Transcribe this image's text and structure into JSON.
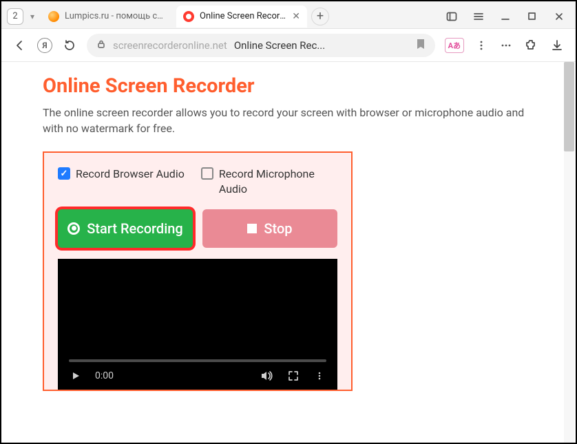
{
  "window": {
    "tab_count": "2"
  },
  "tabs": [
    {
      "label": "Lumpics.ru - помощь с кон",
      "active": false
    },
    {
      "label": "Online Screen Recorder",
      "active": true
    }
  ],
  "addressbar": {
    "domain": "screenrecorderonline.net",
    "page_title_short": "Online Screen Rec...",
    "translate_badge": "Aあ"
  },
  "page": {
    "heading": "Online Screen Recorder",
    "lead": "The online screen recorder allows you to record your screen with browser or microphone audio and with no watermark for free."
  },
  "recorder": {
    "checkbox_browser_audio": "Record Browser Audio",
    "checkbox_mic_audio": "Record Microphone Audio",
    "start_label": "Start Recording",
    "stop_label": "Stop"
  },
  "video": {
    "time": "0:00"
  }
}
